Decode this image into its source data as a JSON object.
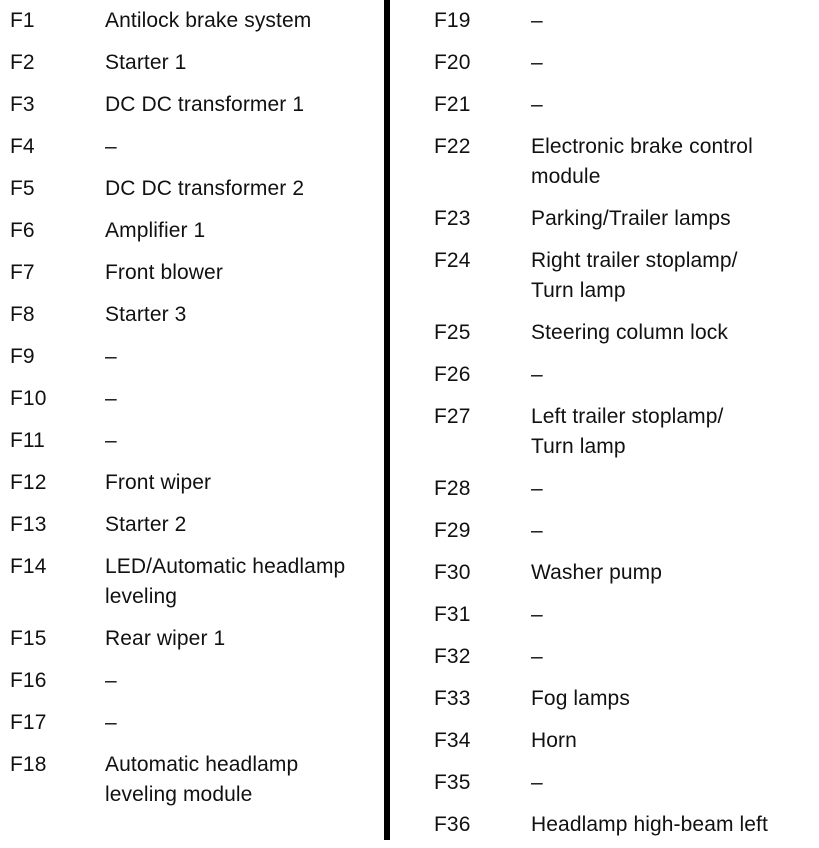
{
  "document": {
    "kind": "fuse-box-legend",
    "text_color": "#111111",
    "background_color": "#ffffff",
    "divider_color": "#000000"
  },
  "columns": [
    {
      "name": "left-column",
      "rows": [
        {
          "label": "F1",
          "description": "Antilock brake system",
          "lines": 1
        },
        {
          "label": "F2",
          "description": "Starter 1",
          "lines": 1
        },
        {
          "label": "F3",
          "description": "DC DC transformer 1",
          "lines": 1
        },
        {
          "label": "F4",
          "description": "–",
          "lines": 1
        },
        {
          "label": "F5",
          "description": "DC DC transformer 2",
          "lines": 1
        },
        {
          "label": "F6",
          "description": "Amplifier 1",
          "lines": 1
        },
        {
          "label": "F7",
          "description": "Front blower",
          "lines": 1
        },
        {
          "label": "F8",
          "description": "Starter 3",
          "lines": 1
        },
        {
          "label": "F9",
          "description": "–",
          "lines": 1
        },
        {
          "label": "F10",
          "description": "–",
          "lines": 1
        },
        {
          "label": "F11",
          "description": "–",
          "lines": 1
        },
        {
          "label": "F12",
          "description": "Front wiper",
          "lines": 1
        },
        {
          "label": "F13",
          "description": "Starter 2",
          "lines": 1
        },
        {
          "label": "F14",
          "description": "LED/Automatic headlamp\nleveling",
          "lines": 2
        },
        {
          "label": "F15",
          "description": "Rear wiper 1",
          "lines": 1
        },
        {
          "label": "F16",
          "description": "–",
          "lines": 1
        },
        {
          "label": "F17",
          "description": "–",
          "lines": 1
        },
        {
          "label": "F18",
          "description": "Automatic headlamp\nleveling module",
          "lines": 2
        }
      ]
    },
    {
      "name": "right-column",
      "rows": [
        {
          "label": "F19",
          "description": "–",
          "lines": 1
        },
        {
          "label": "F20",
          "description": "–",
          "lines": 1
        },
        {
          "label": "F21",
          "description": "–",
          "lines": 1
        },
        {
          "label": "F22",
          "description": "Electronic brake control\nmodule",
          "lines": 2
        },
        {
          "label": "F23",
          "description": "Parking/Trailer lamps",
          "lines": 1
        },
        {
          "label": "F24",
          "description": "Right trailer stoplamp/\nTurn lamp",
          "lines": 2
        },
        {
          "label": "F25",
          "description": "Steering column lock",
          "lines": 1
        },
        {
          "label": "F26",
          "description": "–",
          "lines": 1
        },
        {
          "label": "F27",
          "description": "Left trailer stoplamp/\nTurn lamp",
          "lines": 2
        },
        {
          "label": "F28",
          "description": "–",
          "lines": 1
        },
        {
          "label": "F29",
          "description": "–",
          "lines": 1
        },
        {
          "label": "F30",
          "description": "Washer pump",
          "lines": 1
        },
        {
          "label": "F31",
          "description": "–",
          "lines": 1
        },
        {
          "label": "F32",
          "description": "–",
          "lines": 1
        },
        {
          "label": "F33",
          "description": "Fog lamps",
          "lines": 1
        },
        {
          "label": "F34",
          "description": "Horn",
          "lines": 1
        },
        {
          "label": "F35",
          "description": "–",
          "lines": 1
        },
        {
          "label": "F36",
          "description": "Headlamp high-beam left",
          "lines": 1
        }
      ]
    }
  ]
}
